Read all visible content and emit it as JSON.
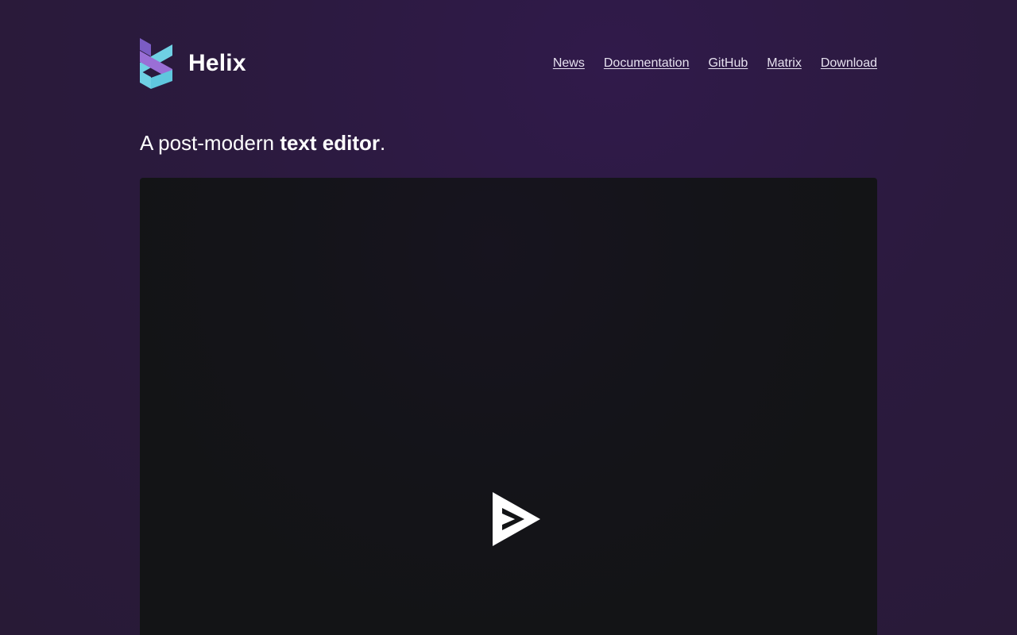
{
  "header": {
    "brand_name": "Helix",
    "logo_icon": "helix-logo-icon",
    "nav": [
      {
        "label": "News"
      },
      {
        "label": "Documentation"
      },
      {
        "label": "GitHub"
      },
      {
        "label": "Matrix"
      },
      {
        "label": "Download"
      }
    ]
  },
  "hero": {
    "tagline_prefix": "A post-modern ",
    "tagline_bold": "text editor",
    "tagline_suffix": "."
  },
  "player": {
    "play_icon": "asciinema-play-icon"
  },
  "colors": {
    "page_background": "#2a1a3c",
    "player_background": "#131416",
    "logo_purple": "#8d68d2",
    "logo_cyan": "#68cde0",
    "text": "#ffffff",
    "nav_link": "#e6e1ef"
  }
}
